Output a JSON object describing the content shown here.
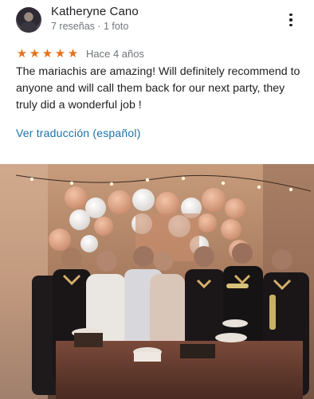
{
  "review": {
    "author": "Katheryne Cano",
    "meta": "7 reseñas · 1 foto",
    "rating": 5,
    "time": "Hace 4 años",
    "text": "The mariachis are amazing! Will definitely recommend to anyone and will call them back for our next party, they truly did a wonderful job !",
    "translate_label": "Ver traducción (español)"
  },
  "icons": {
    "avatar": "avatar",
    "more": "more-vert-icon",
    "star": "star-icon"
  },
  "photo": {
    "description_name": "review-photo"
  },
  "colors": {
    "star": "#e7711b",
    "link": "#1a73a8",
    "muted": "#70757a",
    "text": "#202124"
  }
}
